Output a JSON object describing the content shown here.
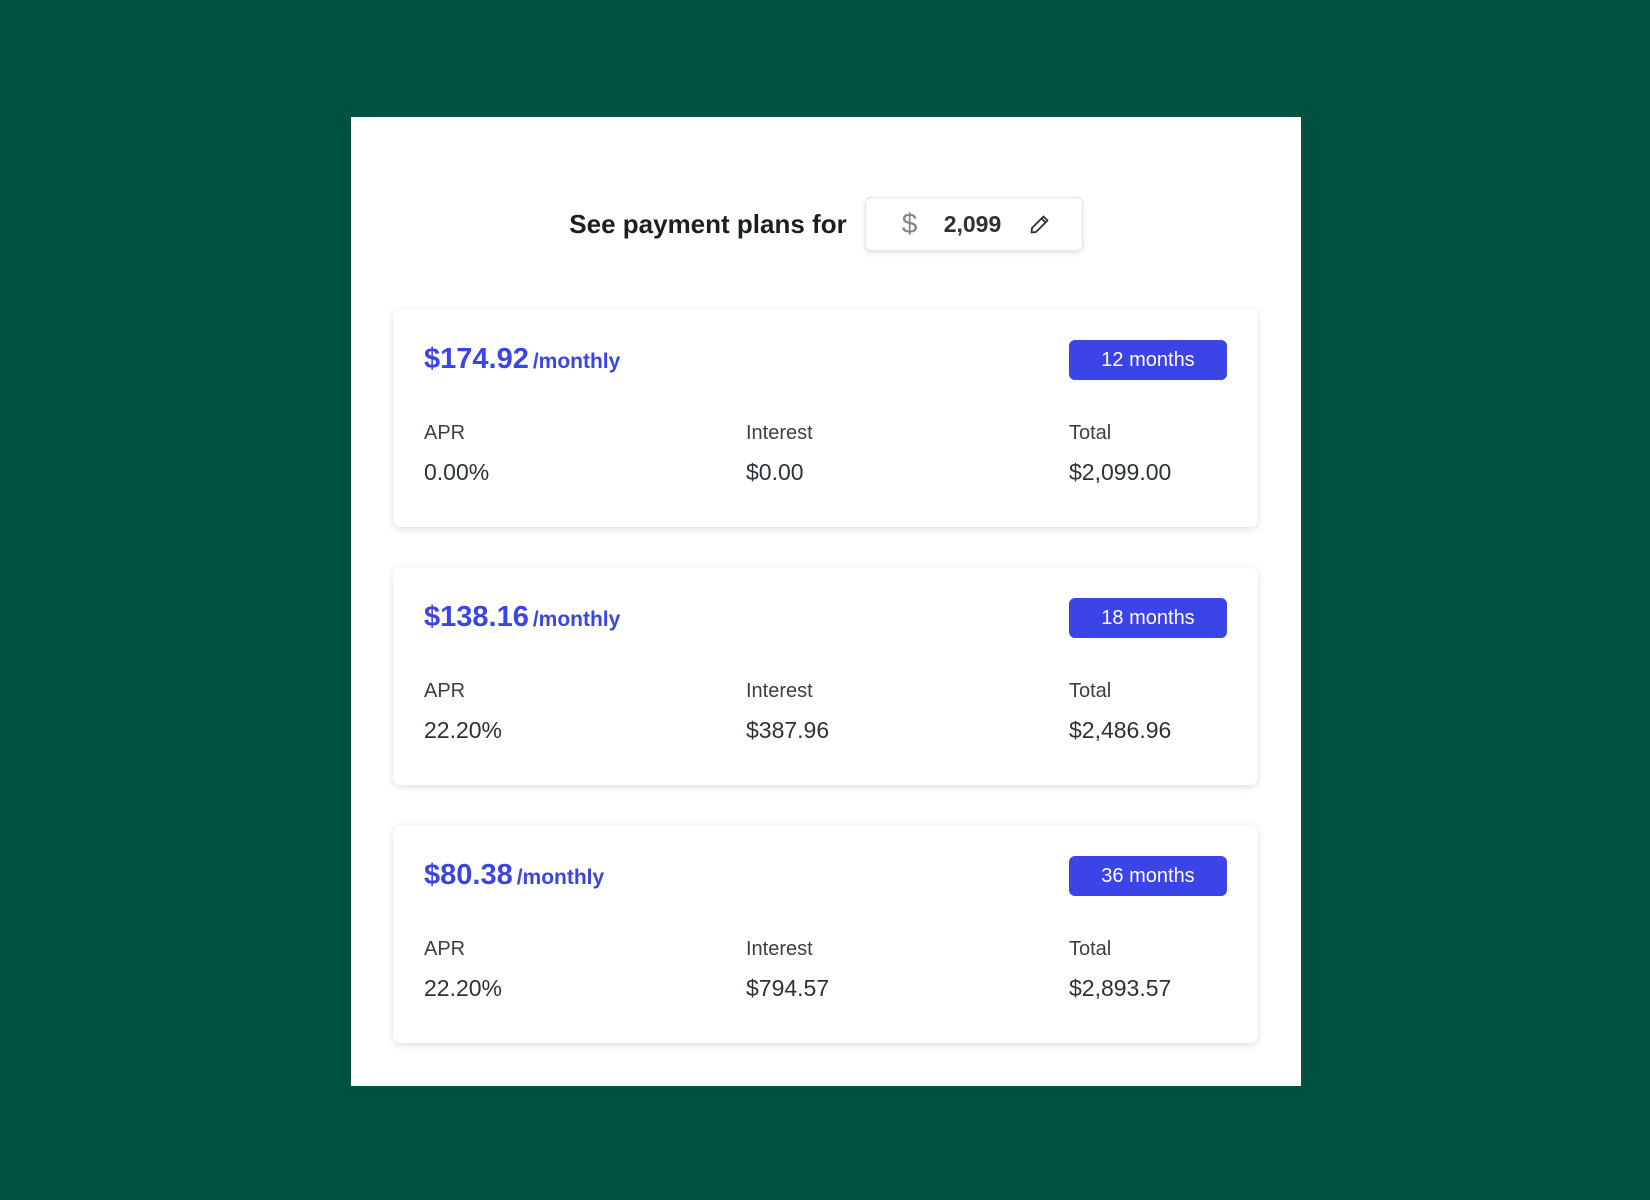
{
  "header": {
    "title": "See payment plans for",
    "currency_symbol": "$",
    "amount": "2,099"
  },
  "plans": [
    {
      "monthly_amount": "$174.92",
      "monthly_suffix": "/monthly",
      "term": "12 months",
      "apr_label": "APR",
      "apr": "0.00%",
      "interest_label": "Interest",
      "interest": "$0.00",
      "total_label": "Total",
      "total": "$2,099.00"
    },
    {
      "monthly_amount": "$138.16",
      "monthly_suffix": "/monthly",
      "term": "18 months",
      "apr_label": "APR",
      "apr": "22.20%",
      "interest_label": "Interest",
      "interest": "$387.96",
      "total_label": "Total",
      "total": "$2,486.96"
    },
    {
      "monthly_amount": "$80.38",
      "monthly_suffix": "/monthly",
      "term": "36 months",
      "apr_label": "APR",
      "apr": "22.20%",
      "interest_label": "Interest",
      "interest": "$794.57",
      "total_label": "Total",
      "total": "$2,893.57"
    }
  ],
  "colors": {
    "background": "#005240",
    "accent": "#3b44e6",
    "panel": "#ffffff",
    "text": "#2d3236"
  },
  "icons": {
    "edit": "pencil-icon"
  }
}
